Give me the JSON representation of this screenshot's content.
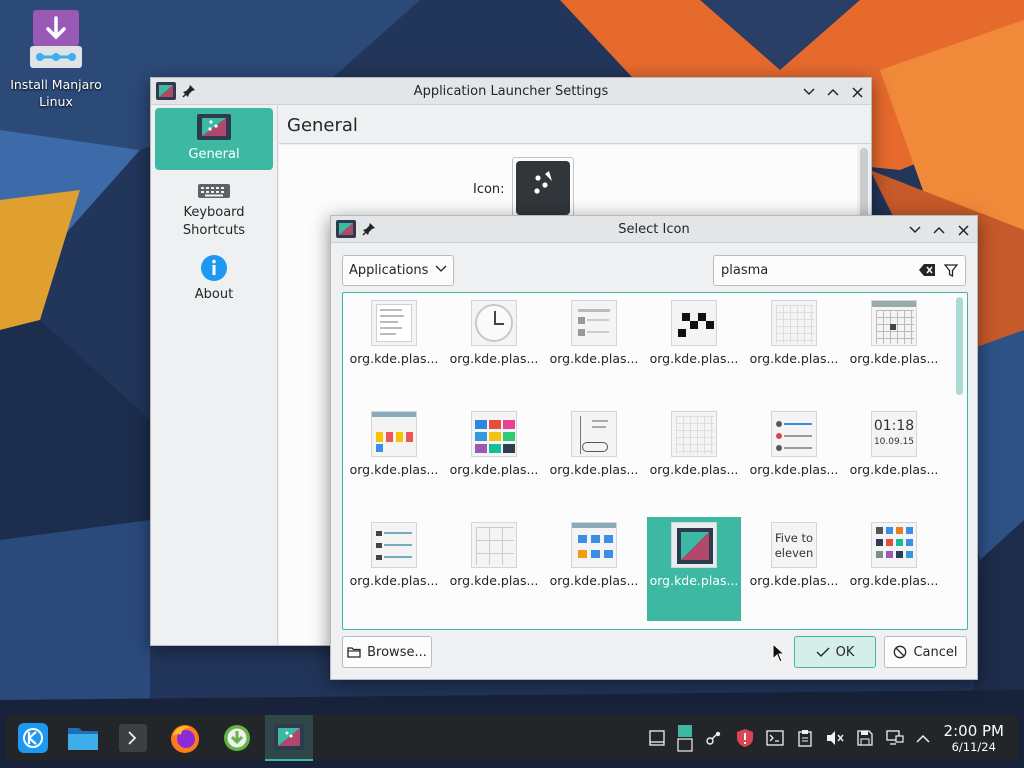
{
  "desktop": {
    "install_icon_label": "Install Manjaro Linux"
  },
  "settings_window": {
    "title": "Application Launcher Settings",
    "sidebar": [
      {
        "label": "General",
        "icon": "app-launcher-icon",
        "active": true
      },
      {
        "label": "Keyboard Shortcuts",
        "icon": "keyboard-icon",
        "active": false
      },
      {
        "label": "About",
        "icon": "info-icon",
        "active": false
      }
    ],
    "page_title": "General",
    "icon_label": "Icon:"
  },
  "dialog": {
    "title": "Select Icon",
    "category": "Applications",
    "search_value": "plasma",
    "icons": [
      {
        "name": "org.kde.plas...",
        "thumb": "menu"
      },
      {
        "name": "org.kde.plas...",
        "thumb": "clock"
      },
      {
        "name": "org.kde.plas...",
        "thumb": "list"
      },
      {
        "name": "org.kde.plas...",
        "thumb": "checker"
      },
      {
        "name": "org.kde.plas...",
        "thumb": "calendar"
      },
      {
        "name": "org.kde.plas...",
        "thumb": "calendar-dark"
      },
      {
        "name": "org.kde.plas...",
        "thumb": "swatches"
      },
      {
        "name": "org.kde.plas...",
        "thumb": "colorgrid"
      },
      {
        "name": "org.kde.plas...",
        "thumb": "comic"
      },
      {
        "name": "org.kde.plas...",
        "thumb": "calendar"
      },
      {
        "name": "org.kde.plas...",
        "thumb": "sysinfo"
      },
      {
        "name": "org.kde.plas...",
        "thumb": "digital-clock",
        "text1": "01:18",
        "text2": "10.09.15"
      },
      {
        "name": "org.kde.plas...",
        "thumb": "taskrows"
      },
      {
        "name": "org.kde.plas...",
        "thumb": "keypad"
      },
      {
        "name": "org.kde.plas...",
        "thumb": "folders"
      },
      {
        "name": "org.kde.plas...",
        "thumb": "kickoff",
        "selected": true
      },
      {
        "name": "org.kde.plas...",
        "thumb": "fuzzy-clock",
        "text1": "Five to",
        "text2": "eleven"
      },
      {
        "name": "org.kde.plas...",
        "thumb": "appgrid"
      }
    ],
    "browse_label": "Browse...",
    "ok_label": "OK",
    "cancel_label": "Cancel"
  },
  "taskbar": {
    "time": "2:00 PM",
    "date": "6/11/24"
  },
  "colors": {
    "accent": "#3db8a2",
    "panel": "#232629"
  }
}
